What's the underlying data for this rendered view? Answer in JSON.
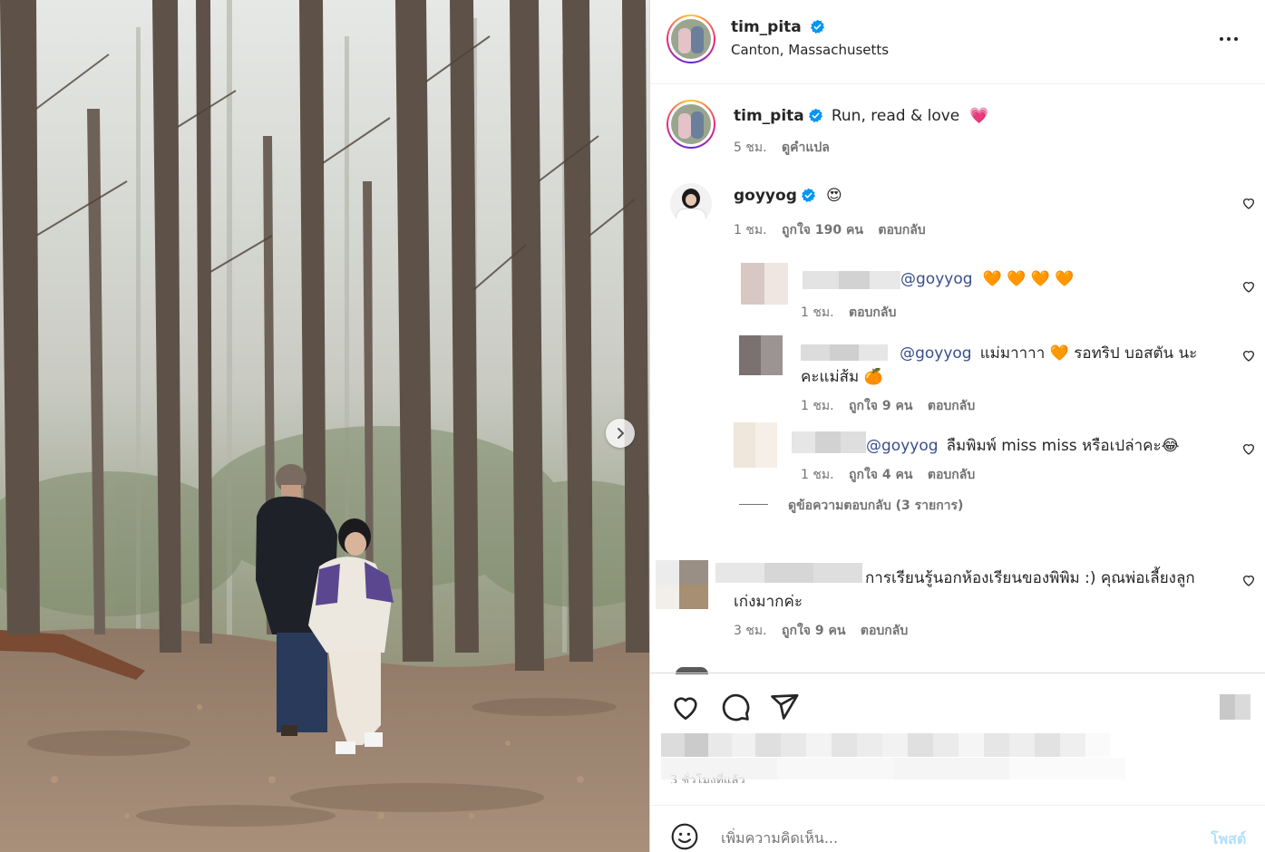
{
  "post": {
    "username": "tim_pita",
    "location": "Canton, Massachusetts",
    "caption": "Run, read & love",
    "caption_emoji": "💗",
    "caption_time": "5 ชม.",
    "translate_label": "ดูคำแปล"
  },
  "comments": [
    {
      "username": "goyyog",
      "emoji": "😍",
      "time": "1 ชม.",
      "likes": "ถูกใจ 190 คน",
      "reply_label": "ตอบกลับ"
    }
  ],
  "replies": [
    {
      "mention": "@goyyog",
      "text": "🧡 🧡 🧡 🧡",
      "time": "1 ชม.",
      "reply_label": "ตอบกลับ"
    },
    {
      "name_fragment": "y_p      e",
      "mention": "@goyyog",
      "text_line1": "แม่มาาาา 🧡 รอทริป บอสตัน นะ",
      "text_line2": "คะแม่ส้ม 🍊",
      "time": "1 ชม.",
      "likes": "ถูกใจ 9 คน",
      "reply_label": "ตอบกลับ"
    },
    {
      "mention": "@goyyog",
      "text": "ลืมพิมพ์ miss miss หรือเปล่าคะ😂",
      "time": "1 ชม.",
      "likes": "ถูกใจ 4 คน",
      "reply_label": "ตอบกลับ"
    }
  ],
  "view_replies_label": "ดูข้อความตอบกลับ (3 รายการ)",
  "comment2": {
    "text_line1": "การเรียนรู้นอกห้องเรียนของพิพิม :) คุณพ่อเลี้ยงลูก",
    "text_line2": "เก่งมากค่ะ",
    "time": "3 ชม.",
    "likes": "ถูกใจ 9 คน",
    "reply_label": "ตอบกลับ"
  },
  "footer": {
    "time_ago": "3 ชั่วโมงที่แล้ว",
    "comment_placeholder": "เพิ่มความคิดเห็น...",
    "post_label": "โพสต์"
  },
  "icons": {
    "more": "more-icon",
    "like": "heart-icon",
    "comment": "comment-icon",
    "share": "share-icon",
    "save": "bookmark-icon",
    "emoji": "emoji-icon",
    "next": "chevron-right-icon",
    "verified": "verified-badge-icon"
  },
  "colors": {
    "verified": "#0095f6",
    "link": "#3a4f8a",
    "post_button": "#b2dffc",
    "heart_emoji": "#ef4f78"
  }
}
